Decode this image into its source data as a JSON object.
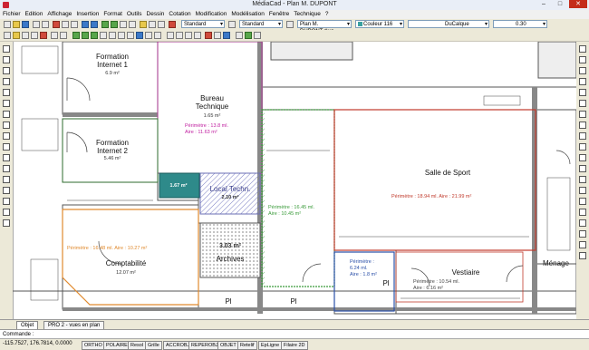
{
  "window": {
    "title": "MédiaCad - Plan M. DUPONT",
    "minimize": "–",
    "maximize": "□",
    "close": "✕"
  },
  "menu": [
    "Fichier",
    "Edition",
    "Affichage",
    "Insertion",
    "Format",
    "Outils",
    "Dessin",
    "Cotation",
    "Modification",
    "Modélisation",
    "Fenêtre",
    "Technique",
    "?"
  ],
  "toolbar": {
    "style1": "Standard",
    "style2": "Standard",
    "drawing_file": "Plan M. DUPONT.dwg",
    "color": "Couleur 116",
    "linetype": "DuCalque",
    "lineweight": "0.30"
  },
  "rooms": [
    {
      "name": "Formation\nInternet 1",
      "area": "6.9 m²"
    },
    {
      "name": "Formation\nInternet 2",
      "area": "5.46 m²"
    },
    {
      "name": "Bureau\nTechnique",
      "area": "1.65 m²",
      "perim": "Périmètre : 13.8 ml.\nAire : 11.63 m²"
    },
    {
      "name": "Local Techn.",
      "area": "2.10 m²"
    },
    {
      "name": "Archives",
      "area": "3.03 m²"
    },
    {
      "name": "Comptabilité",
      "area": "12.07 m²",
      "perim": "Périmètre : 16.48 ml. Aire : 10.27 m²"
    },
    {
      "name": "Salle de Sport",
      "perim": "Périmètre : 18.94 ml. Aire : 21.99 m²"
    },
    {
      "name": "Vestiaire",
      "perim": "Périmètre : 10.54 ml.\nAire : 6.16 m²"
    },
    {
      "name": "Ménage"
    }
  ],
  "labels": {
    "green_room_perim": "Périmètre : 16.45 ml.\nAire : 10.45 m²",
    "blue_room_perim": "Périmètre :\n6.24 ml.\nAire : 1.8 m²",
    "small_area": "1.67 m²",
    "pl": "Pl",
    "pl2": "Pl",
    "pl3": "Pl"
  },
  "tabs": [
    "Objet",
    "PRO 2 - vues en plan"
  ],
  "command": "Commande :",
  "status": {
    "coords": "-115.7527, 176.7814, 0.0000",
    "toggles": [
      "ORTHO",
      "POLAIRE",
      "Resol",
      "Grille",
      "ACCROBJ",
      "REPEROBJ",
      "OBJET",
      "Retelif",
      "EpLigne",
      "Filaire 2D"
    ]
  },
  "colors": {
    "red": "#c0392b",
    "green": "#3a9b3a",
    "blue": "#2a4fa8",
    "orange": "#e08a2e",
    "magenta": "#c020a0",
    "hatch": "#6b6fb5"
  }
}
